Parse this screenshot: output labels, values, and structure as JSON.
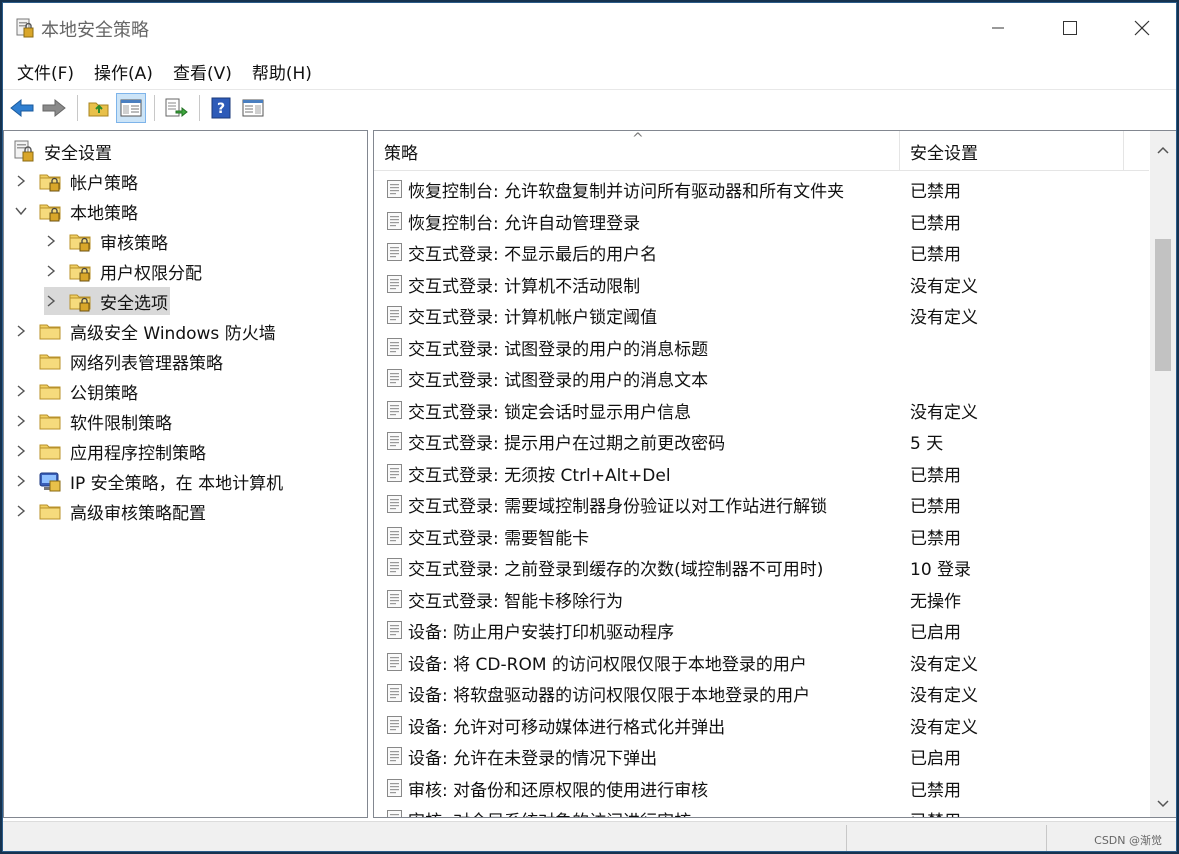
{
  "window": {
    "title": "本地安全策略"
  },
  "menu": [
    "文件(F)",
    "操作(A)",
    "查看(V)",
    "帮助(H)"
  ],
  "tree": [
    {
      "label": "安全设置",
      "level": 0,
      "expander": "none",
      "icon": "shield-icon"
    },
    {
      "label": "帐户策略",
      "level": 1,
      "expander": "collapsed",
      "icon": "lock-folder-icon"
    },
    {
      "label": "本地策略",
      "level": 1,
      "expander": "expanded",
      "icon": "lock-folder-icon"
    },
    {
      "label": "审核策略",
      "level": 2,
      "expander": "collapsed",
      "icon": "lock-folder-icon"
    },
    {
      "label": "用户权限分配",
      "level": 2,
      "expander": "collapsed",
      "icon": "lock-folder-icon"
    },
    {
      "label": "安全选项",
      "level": 2,
      "expander": "collapsed",
      "icon": "lock-folder-icon",
      "selected": true
    },
    {
      "label": "高级安全 Windows 防火墙",
      "level": 1,
      "expander": "collapsed",
      "icon": "folder-icon"
    },
    {
      "label": "网络列表管理器策略",
      "level": 1,
      "expander": "none",
      "icon": "folder-icon"
    },
    {
      "label": "公钥策略",
      "level": 1,
      "expander": "collapsed",
      "icon": "folder-icon"
    },
    {
      "label": "软件限制策略",
      "level": 1,
      "expander": "collapsed",
      "icon": "folder-icon"
    },
    {
      "label": "应用程序控制策略",
      "level": 1,
      "expander": "collapsed",
      "icon": "folder-icon"
    },
    {
      "label": "IP 安全策略，在 本地计算机",
      "level": 1,
      "expander": "collapsed",
      "icon": "ip-security-icon"
    },
    {
      "label": "高级审核策略配置",
      "level": 1,
      "expander": "collapsed",
      "icon": "folder-icon"
    }
  ],
  "columns": {
    "policy": "策略",
    "setting": "安全设置"
  },
  "rows": [
    {
      "policy": "恢复控制台: 允许软盘复制并访问所有驱动器和所有文件夹",
      "setting": "已禁用"
    },
    {
      "policy": "恢复控制台: 允许自动管理登录",
      "setting": "已禁用"
    },
    {
      "policy": "交互式登录: 不显示最后的用户名",
      "setting": "已禁用"
    },
    {
      "policy": "交互式登录: 计算机不活动限制",
      "setting": "没有定义"
    },
    {
      "policy": "交互式登录: 计算机帐户锁定阈值",
      "setting": "没有定义"
    },
    {
      "policy": "交互式登录: 试图登录的用户的消息标题",
      "setting": ""
    },
    {
      "policy": "交互式登录: 试图登录的用户的消息文本",
      "setting": ""
    },
    {
      "policy": "交互式登录: 锁定会话时显示用户信息",
      "setting": "没有定义"
    },
    {
      "policy": "交互式登录: 提示用户在过期之前更改密码",
      "setting": "5 天"
    },
    {
      "policy": "交互式登录: 无须按 Ctrl+Alt+Del",
      "setting": "已禁用"
    },
    {
      "policy": "交互式登录: 需要域控制器身份验证以对工作站进行解锁",
      "setting": "已禁用"
    },
    {
      "policy": "交互式登录: 需要智能卡",
      "setting": "已禁用"
    },
    {
      "policy": "交互式登录: 之前登录到缓存的次数(域控制器不可用时)",
      "setting": "10 登录"
    },
    {
      "policy": "交互式登录: 智能卡移除行为",
      "setting": "无操作"
    },
    {
      "policy": "设备: 防止用户安装打印机驱动程序",
      "setting": "已启用"
    },
    {
      "policy": "设备: 将 CD-ROM 的访问权限仅限于本地登录的用户",
      "setting": "没有定义"
    },
    {
      "policy": "设备: 将软盘驱动器的访问权限仅限于本地登录的用户",
      "setting": "没有定义"
    },
    {
      "policy": "设备: 允许对可移动媒体进行格式化并弹出",
      "setting": "没有定义"
    },
    {
      "policy": "设备: 允许在未登录的情况下弹出",
      "setting": "已启用"
    },
    {
      "policy": "审核: 对备份和还原权限的使用进行审核",
      "setting": "已禁用"
    },
    {
      "policy": "审核: 对全局系统对象的访问进行审核",
      "setting": "已禁用"
    }
  ],
  "watermark": "CSDN @渐觉"
}
